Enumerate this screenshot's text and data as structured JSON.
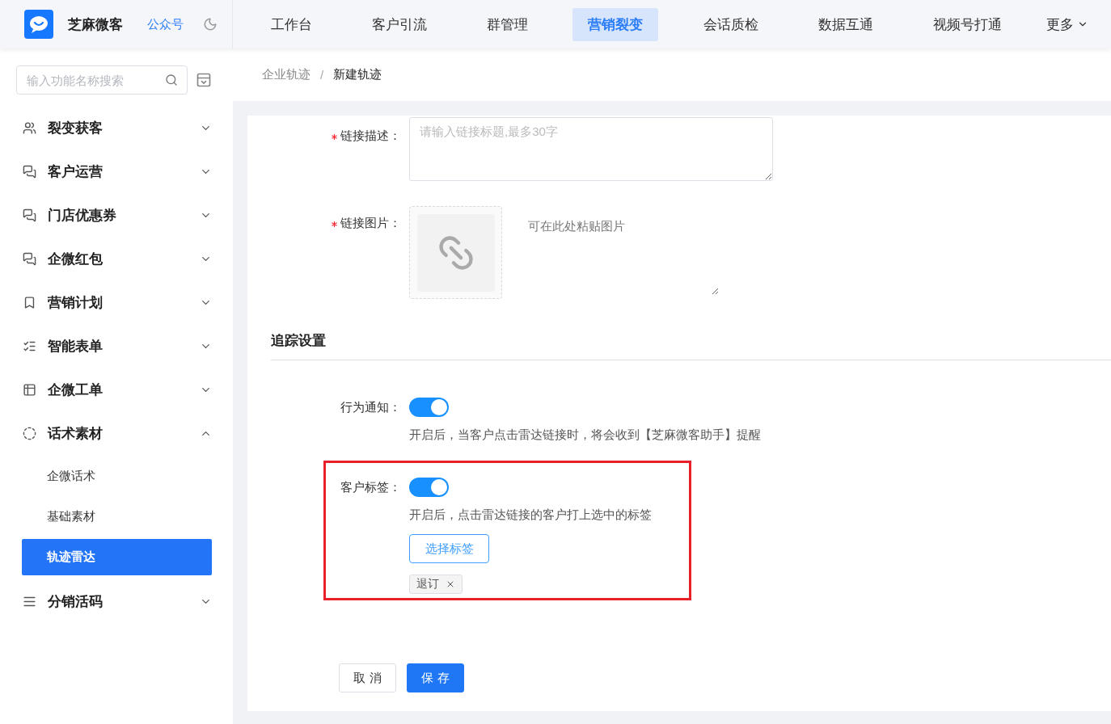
{
  "brand": {
    "name": "芝麻微客",
    "link": "公众号"
  },
  "nav": [
    {
      "label": "工作台",
      "selected": false
    },
    {
      "label": "客户引流",
      "selected": false
    },
    {
      "label": "群管理",
      "selected": false
    },
    {
      "label": "营销裂变",
      "selected": true
    },
    {
      "label": "会话质检",
      "selected": false
    },
    {
      "label": "数据互通",
      "selected": false
    },
    {
      "label": "视频号打通",
      "selected": false
    }
  ],
  "nav_more": "更多",
  "sidebar": {
    "search": {
      "placeholder": "输入功能名称搜索"
    },
    "items": [
      {
        "label": "裂变获客",
        "expanded": false
      },
      {
        "label": "客户运营",
        "expanded": false
      },
      {
        "label": "门店优惠券",
        "expanded": false
      },
      {
        "label": "企微红包",
        "expanded": false
      },
      {
        "label": "营销计划",
        "expanded": false
      },
      {
        "label": "智能表单",
        "expanded": false
      },
      {
        "label": "企微工单",
        "expanded": false
      },
      {
        "label": "话术素材",
        "expanded": true,
        "children": [
          {
            "label": "企微话术",
            "selected": false
          },
          {
            "label": "基础素材",
            "selected": false
          },
          {
            "label": "轨迹雷达",
            "selected": true
          }
        ]
      },
      {
        "label": "分销活码",
        "expanded": false
      }
    ]
  },
  "breadcrumb": [
    "企业轨迹",
    "新建轨迹"
  ],
  "breadcrumb_separator": "/",
  "form": {
    "description": {
      "label": "链接描述：",
      "required": true,
      "placeholder": "请输入链接标题,最多30字"
    },
    "image": {
      "label": "链接图片：",
      "required": true,
      "placeholder": "可在此处粘贴图片"
    },
    "section_title": "追踪设置",
    "notify": {
      "label": "行为通知：",
      "on": true,
      "hint": "开启后，当客户点击雷达链接时，将会收到【芝麻微客助手】提醒"
    },
    "tagging": {
      "label": "客户标签：",
      "on": true,
      "hint": "开启后，点击雷达链接的客户打上选中的标签",
      "button": "选择标签",
      "tags": [
        "退订"
      ]
    },
    "buttons": {
      "cancel": "取 消",
      "save": "保 存"
    }
  }
}
